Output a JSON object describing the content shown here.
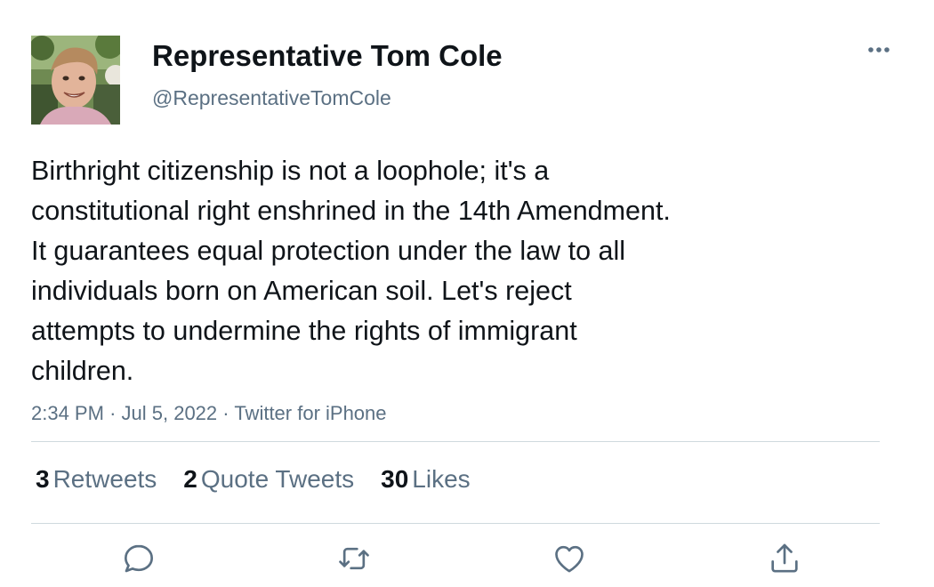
{
  "author": {
    "display_name": "Representative Tom Cole",
    "handle": "@RepresentativeTomCole",
    "avatar_icon": "profile-photo"
  },
  "tweet": {
    "text": "Birthright citizenship is not a loophole; it's a\nconstitutional right enshrined in the 14th Amendment.\nIt guarantees equal protection under the law to all\nindividuals born on American soil. Let's reject\nattempts to undermine the rights of immigrant\nchildren.",
    "time": "2:34 PM",
    "separator": "·",
    "date": "Jul 5, 2022",
    "source": "Twitter for iPhone"
  },
  "stats": {
    "retweets_count": "3",
    "retweets_label": "Retweets",
    "quotes_count": "2",
    "quotes_label": "Quote Tweets",
    "likes_count": "30",
    "likes_label": "Likes"
  },
  "actions": {
    "reply_icon": "reply-icon",
    "retweet_icon": "retweet-icon",
    "like_icon": "heart-icon",
    "share_icon": "share-icon",
    "more_icon": "more-horizontal-icon"
  },
  "colors": {
    "text_primary": "#0f1419",
    "text_secondary": "#5b7083",
    "divider": "#cfd9de",
    "background": "#ffffff"
  }
}
